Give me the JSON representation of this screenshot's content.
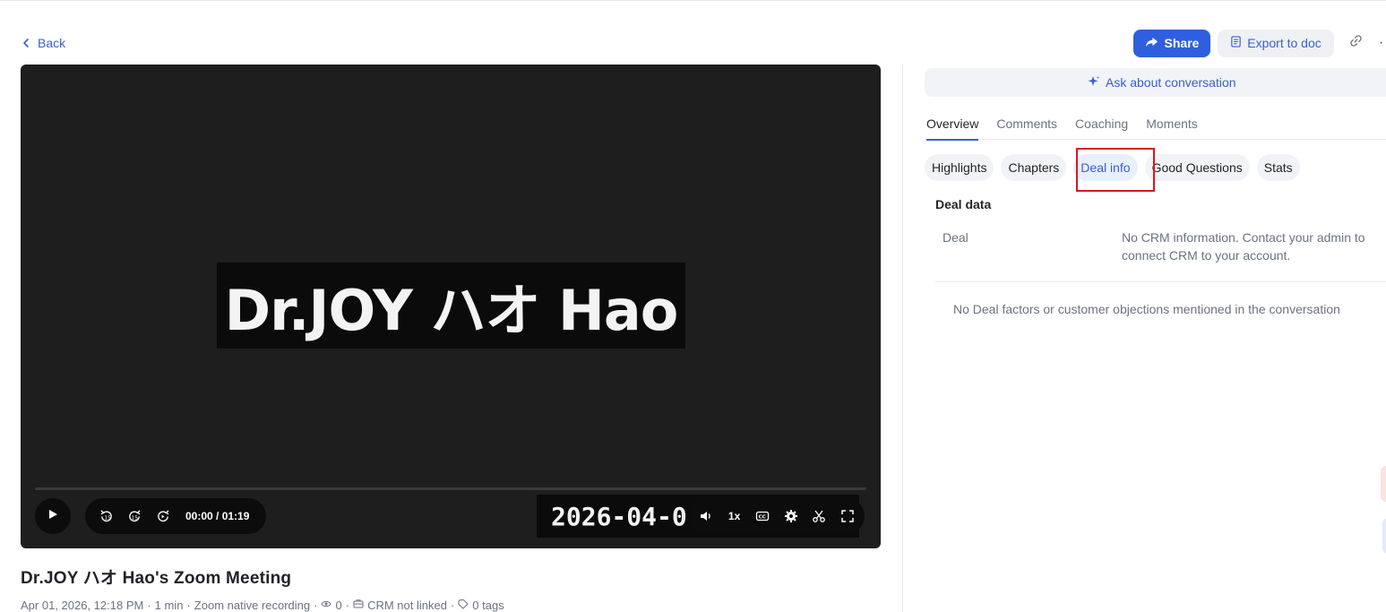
{
  "nav": {
    "back_label": "Back"
  },
  "toolbar": {
    "share_label": "Share",
    "export_label": "Export to doc",
    "more_label": "···"
  },
  "video": {
    "name_card": "Dr.JOY ハオ Hao",
    "date_burn": "2026-04-0",
    "timecode": "00:00 / 01:19",
    "speed": "1x",
    "captions": "CC",
    "progress": 0.0
  },
  "meeting": {
    "title": "Dr.JOY ハオ Hao's Zoom Meeting",
    "date": "Apr 01, 2026, 12:18 PM",
    "duration": "1 min",
    "source": "Zoom native recording",
    "views": "0",
    "crm": "CRM not linked",
    "tags": "0 tags"
  },
  "ask": {
    "label": "Ask about conversation"
  },
  "tabs": [
    {
      "label": "Overview",
      "active": true
    },
    {
      "label": "Comments",
      "active": false
    },
    {
      "label": "Coaching",
      "active": false
    },
    {
      "label": "Moments",
      "active": false
    }
  ],
  "chips": [
    {
      "label": "Highlights",
      "active": false
    },
    {
      "label": "Chapters",
      "active": false
    },
    {
      "label": "Deal info",
      "active": true
    },
    {
      "label": "Good Questions",
      "active": false
    },
    {
      "label": "Stats",
      "active": false
    }
  ],
  "deal": {
    "heading": "Deal data",
    "label": "Deal",
    "value": "No CRM information. Contact your admin to connect CRM to your account.",
    "empty_message": "No Deal factors or customer objections mentioned in the conversation"
  },
  "colors": {
    "accent": "#3a5fcf",
    "share_bg": "#2f5fde",
    "highlight_box": "#e0141e",
    "video_bg": "#1e1e1e"
  }
}
